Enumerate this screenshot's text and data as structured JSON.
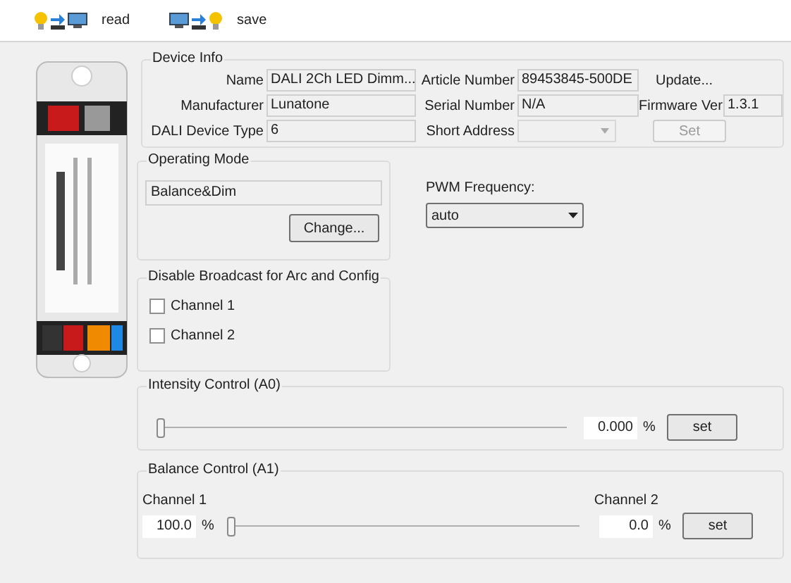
{
  "toolbar": [
    {
      "label": "read",
      "kind": "read"
    },
    {
      "label": "save",
      "kind": "save"
    }
  ],
  "device_info": {
    "title": "Device Info",
    "fields": [
      {
        "label": "Name",
        "value": "DALI 2Ch LED Dimm..."
      },
      {
        "label": "Article Number",
        "value": "89453845-500DE"
      },
      {
        "label": "Manufacturer",
        "value": "Lunatone"
      },
      {
        "label": "Serial Number",
        "value": "N/A"
      },
      {
        "label": "DALI Device Type",
        "value": "6"
      }
    ],
    "update_link": "Update...",
    "firmware": {
      "label": "Firmware Ver",
      "value": "1.3.1"
    },
    "short_address": {
      "label": "Short Address",
      "disabled": true
    },
    "set_button": {
      "label": "Set",
      "disabled": true
    }
  },
  "operating_mode": {
    "title": "Operating Mode",
    "value": "Balance&Dim",
    "button": "Change..."
  },
  "pwm": {
    "label": "PWM Frequency:",
    "value": "auto"
  },
  "broadcast": {
    "title": "Disable Broadcast  for Arc and Config",
    "channels": [
      {
        "label": "Channel 1",
        "checked": false
      },
      {
        "label": "Channel 2",
        "checked": false
      }
    ]
  },
  "intensity": {
    "title": "Intensity Control (A0)",
    "level": 0,
    "value": "0.000",
    "unit": "%",
    "button": "set"
  },
  "balance": {
    "title": "Balance Control (A1)",
    "left_label": "Channel 1",
    "left_value": "100.0",
    "left_unit": "%",
    "level": 0,
    "right_label": "Channel 2",
    "right_value": "0.0",
    "right_unit": "%",
    "button": "set"
  }
}
